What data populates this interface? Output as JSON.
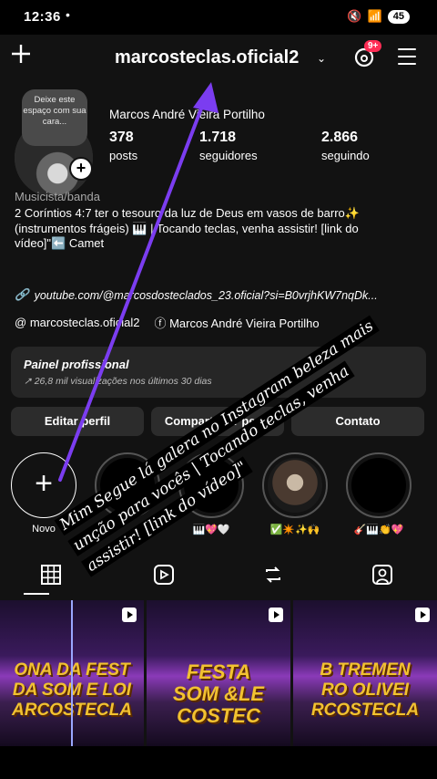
{
  "status": {
    "time": "12:36",
    "dot": "•",
    "battery": "45"
  },
  "header": {
    "username": "marcosteclas.oficial2",
    "notif_badge": "9+"
  },
  "profile": {
    "note": "Deixe este espaço com sua cara...",
    "full_name": "Marcos André Vieira Portilho",
    "stats": [
      {
        "num": "378",
        "label": "posts"
      },
      {
        "num": "1.718",
        "label": "seguidores"
      },
      {
        "num": "2.866",
        "label": "seguindo"
      }
    ],
    "category": "Musicista/banda",
    "bio_line1": "2 Coríntios 4:7 ter o tesouro da luz de Deus em vasos de barro✨",
    "bio_line2": "(instrumentos frágeis) 🎹 | Tocando teclas, venha assistir! [link do",
    "bio_line3": "vídeo]\"⬅️ Camet",
    "link": "youtube.com/@marcosdosteclados_23.oficial?si=B0vrjhKW7nqDk...",
    "threads_handle": "marcosteclas.oficial2",
    "facebook_name": "Marcos André Vieira Portilho"
  },
  "panel": {
    "title": "Painel profissional",
    "subtitle": "↗ 26,8 mil visualizações nos últimos 30 dias"
  },
  "buttons": {
    "edit": "Editar perfil",
    "share": "Compartilhar perfil",
    "contact": "Contato"
  },
  "highlights": [
    {
      "label": "Novo"
    },
    {
      "label": "🎹💖🤍"
    },
    {
      "label": "✅✴️✨🙌"
    },
    {
      "label": "🎸🎹👏💖"
    }
  ],
  "grid": [
    {
      "t1": "ONA DA FEST",
      "t2": "DA SOM E LOI",
      "t3": "ARCOSTECLA"
    },
    {
      "t1": "FESTA",
      "t2": "SOM &LE",
      "t3": "COSTEC"
    },
    {
      "t1": "B TREMEN",
      "t2": "RO OLIVEI",
      "t3": "RCOSTECLA"
    }
  ],
  "overlay": {
    "caption": "Mim Segue lá galera no Instagram beleza mais unção para vocês | Tocando teclas, venha assistir! [link do vídeo]\""
  },
  "colors": {
    "background": "#121212",
    "panel": "#262626",
    "arrow": "#7b3df0",
    "badge": "#ff2d55"
  }
}
